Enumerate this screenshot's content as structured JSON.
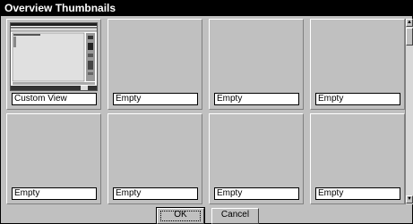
{
  "window": {
    "title": "Overview Thumbnails"
  },
  "thumbnails": [
    {
      "label": "Custom View"
    },
    {
      "label": "Empty"
    },
    {
      "label": "Empty"
    },
    {
      "label": "Empty"
    },
    {
      "label": "Empty"
    },
    {
      "label": "Empty"
    },
    {
      "label": "Empty"
    },
    {
      "label": "Empty"
    }
  ],
  "buttons": {
    "ok": "OK",
    "cancel": "Cancel"
  }
}
